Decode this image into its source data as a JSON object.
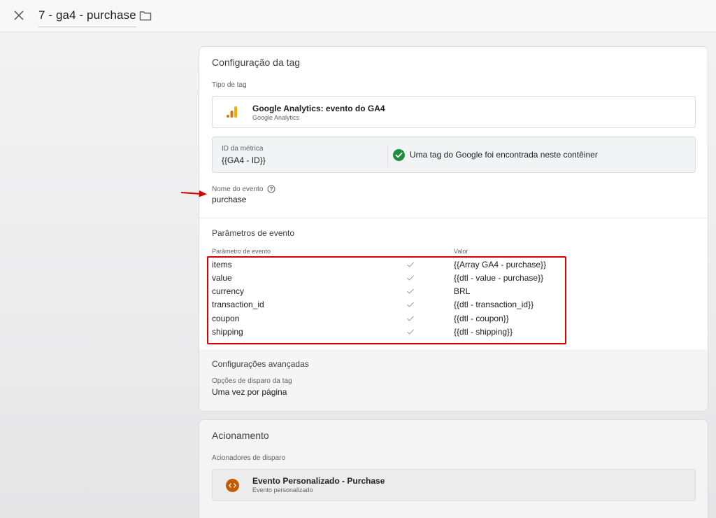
{
  "header": {
    "title": "7 - ga4 - purchase"
  },
  "tag_config": {
    "section_title": "Configuração da tag",
    "tag_type_label": "Tipo de tag",
    "tag_type_name": "Google Analytics: evento do GA4",
    "tag_type_sub": "Google Analytics",
    "metric_id_label": "ID da métrica",
    "metric_id_value": "{{GA4 - ID}}",
    "metric_status": "Uma tag do Google foi encontrada neste contêiner",
    "event_name_label": "Nome do evento",
    "event_name_value": "purchase",
    "params_title": "Parâmetros de evento",
    "params_col_param": "Parâmetro de evento",
    "params_col_value": "Valor",
    "params": [
      {
        "name": "items",
        "value": "{{Array GA4 - purchase}}"
      },
      {
        "name": "value",
        "value": "{{dtl - value - purchase}}"
      },
      {
        "name": "currency",
        "value": "BRL"
      },
      {
        "name": "transaction_id",
        "value": "{{dtl - transaction_id}}"
      },
      {
        "name": "coupon",
        "value": "{{dtl - coupon}}"
      },
      {
        "name": "shipping",
        "value": "{{dtl - shipping}}"
      }
    ],
    "advanced_title": "Configurações avançadas",
    "firing_options_label": "Opções de disparo da tag",
    "firing_options_value": "Uma vez por página"
  },
  "triggering": {
    "section_title": "Acionamento",
    "triggers_label": "Acionadores de disparo",
    "trigger_name": "Evento Personalizado - Purchase",
    "trigger_sub": "Evento personalizado"
  },
  "colors": {
    "highlight": "#d50000",
    "success": "#1e8e3e",
    "ga_orange": "#f9ab00",
    "custom_event": "#c55a00"
  }
}
